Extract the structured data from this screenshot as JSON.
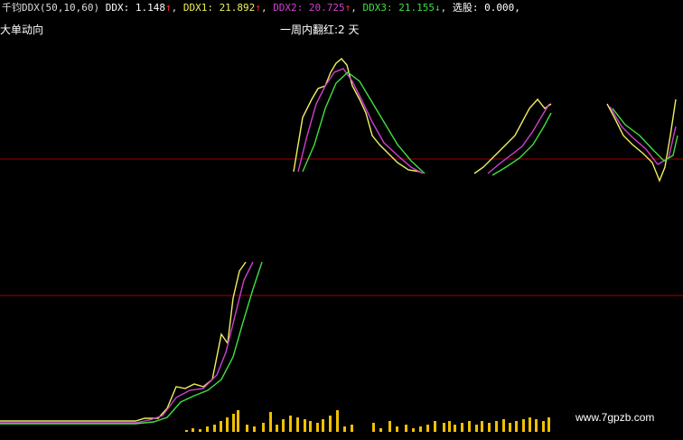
{
  "indicator": {
    "name": "千钧DDX(50,10,60)",
    "ddx": {
      "label": "DDX: 1.148",
      "arrow": "↑"
    },
    "ddx1": {
      "label": "DDX1: 21.892",
      "arrow": "↑"
    },
    "ddx2": {
      "label": "DDX2: 20.725",
      "arrow": "↑"
    },
    "ddx3": {
      "label": "DDX3: 21.155",
      "arrow": "↓"
    },
    "select": {
      "label": "选股: 0.000,"
    }
  },
  "labels": {
    "big_order": "大单动向",
    "week_red": "一周内翻红:2 天",
    "watermark": "www.7gpzb.com"
  },
  "colors": {
    "background": "#000000",
    "ddx1": "#f0f060",
    "ddx2": "#d040d0",
    "ddx3": "#40e040",
    "bars": "#f0c000",
    "ref_line": "#a00000",
    "up_arrow": "#ff3030",
    "down_arrow": "#30e030",
    "legend_default": "#dcdcdc"
  },
  "chart_data": {
    "type": "line",
    "bar_count": 56
  }
}
